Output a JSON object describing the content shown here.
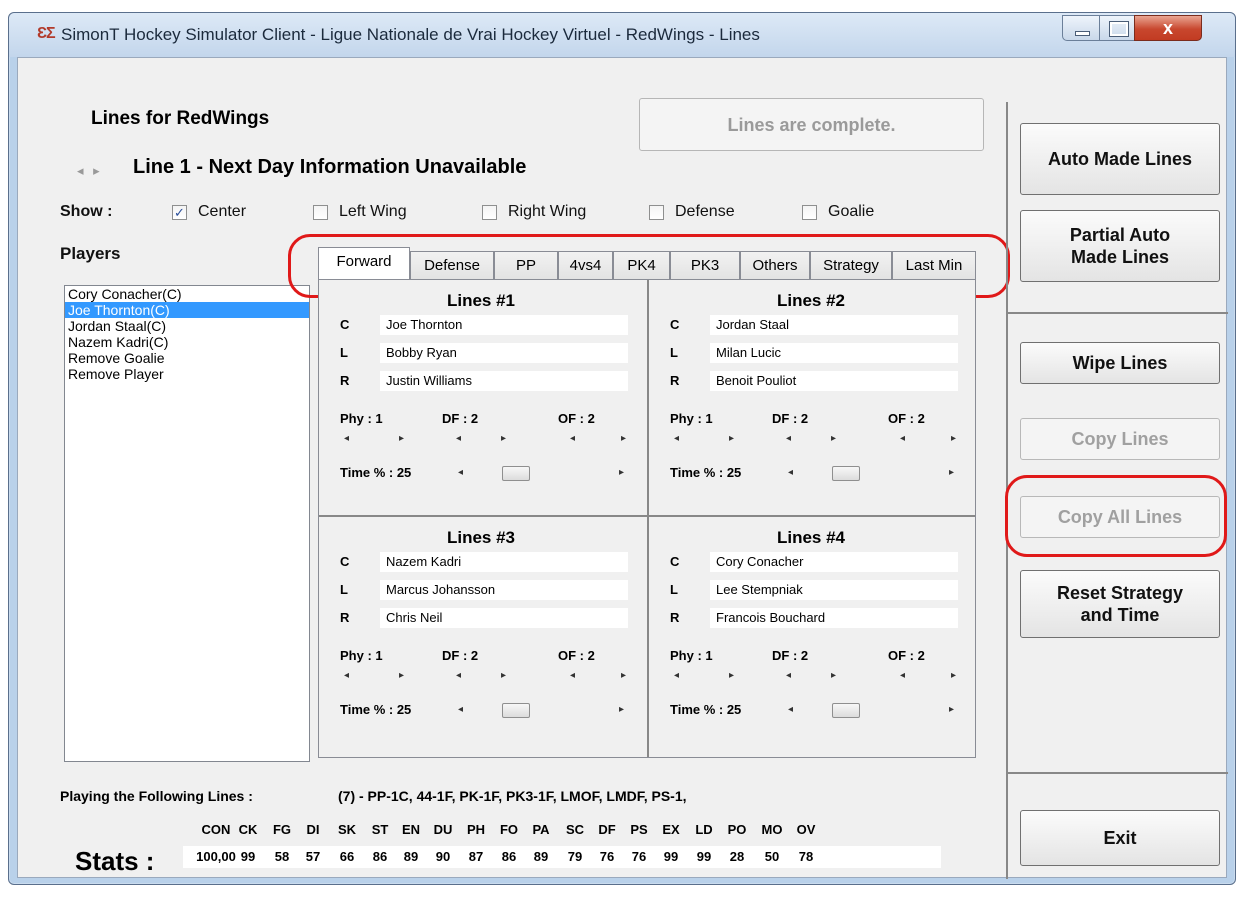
{
  "window": {
    "title": "SimonT Hockey Simulator Client - Ligue Nationale de Vrai Hockey Virtuel - RedWings - Lines",
    "app_icon": "ƐƩ",
    "close_glyph": "x"
  },
  "header": {
    "title": "Lines for RedWings",
    "status": "Lines are complete.",
    "line_nav_glyph": "◂ ▸",
    "line_info": "Line 1 - Next Day Information Unavailable"
  },
  "show": {
    "label": "Show :",
    "options": [
      {
        "label": "Center",
        "checked": true
      },
      {
        "label": "Left Wing",
        "checked": false
      },
      {
        "label": "Right Wing",
        "checked": false
      },
      {
        "label": "Defense",
        "checked": false
      },
      {
        "label": "Goalie",
        "checked": false
      }
    ],
    "check_glyph": "✓"
  },
  "players": {
    "label": "Players",
    "items": [
      "Cory Conacher(C)",
      "Joe Thornton(C)",
      "Jordan Staal(C)",
      "Nazem Kadri(C)",
      "Remove Goalie",
      "Remove Player"
    ],
    "selected_index": 1
  },
  "tabs": [
    "Forward",
    "Defense",
    "PP",
    "4vs4",
    "PK4",
    "PK3",
    "Others",
    "Strategy",
    "Last Min"
  ],
  "active_tab": "Forward",
  "lines": [
    {
      "title": "Lines #1",
      "C": "Joe Thornton",
      "L": "Bobby Ryan",
      "R": "Justin Williams",
      "phy": "Phy : 1",
      "df": "DF : 2",
      "of": "OF : 2",
      "time": "Time % : 25"
    },
    {
      "title": "Lines #2",
      "C": "Jordan Staal",
      "L": "Milan Lucic",
      "R": "Benoit Pouliot",
      "phy": "Phy : 1",
      "df": "DF : 2",
      "of": "OF : 2",
      "time": "Time % : 25"
    },
    {
      "title": "Lines #3",
      "C": "Nazem Kadri",
      "L": "Marcus Johansson",
      "R": "Chris Neil",
      "phy": "Phy : 1",
      "df": "DF : 2",
      "of": "OF : 2",
      "time": "Time % : 25"
    },
    {
      "title": "Lines #4",
      "C": "Cory Conacher",
      "L": "Lee Stempniak",
      "R": "Francois Bouchard",
      "phy": "Phy : 1",
      "df": "DF : 2",
      "of": "OF : 2",
      "time": "Time % : 25"
    }
  ],
  "position_labels": {
    "C": "C",
    "L": "L",
    "R": "R"
  },
  "arrows": {
    "left": "◂",
    "right": "▸"
  },
  "playing": {
    "label": "Playing the Following Lines :",
    "value": "(7) - PP-1C, 44-1F, PK-1F, PK3-1F, LMOF, LMDF, PS-1,"
  },
  "stats": {
    "label": "Stats :",
    "columns": [
      "CON",
      "CK",
      "FG",
      "DI",
      "SK",
      "ST",
      "EN",
      "DU",
      "PH",
      "FO",
      "PA",
      "SC",
      "DF",
      "PS",
      "EX",
      "LD",
      "PO",
      "MO",
      "OV"
    ],
    "values": [
      "100,00",
      "99",
      "58",
      "57",
      "66",
      "86",
      "89",
      "90",
      "87",
      "86",
      "89",
      "79",
      "76",
      "76",
      "99",
      "99",
      "28",
      "50",
      "78"
    ]
  },
  "buttons": {
    "auto": "Auto Made Lines",
    "partial_1": "Partial Auto",
    "partial_2": "Made Lines",
    "wipe": "Wipe Lines",
    "copy": "Copy Lines",
    "copy_all": "Copy All Lines",
    "reset_1": "Reset Strategy",
    "reset_2": "and Time",
    "exit": "Exit"
  },
  "colors": {
    "highlight": "#3399ff",
    "annotation": "#e01919",
    "disabled_text": "#a0a0a0"
  }
}
